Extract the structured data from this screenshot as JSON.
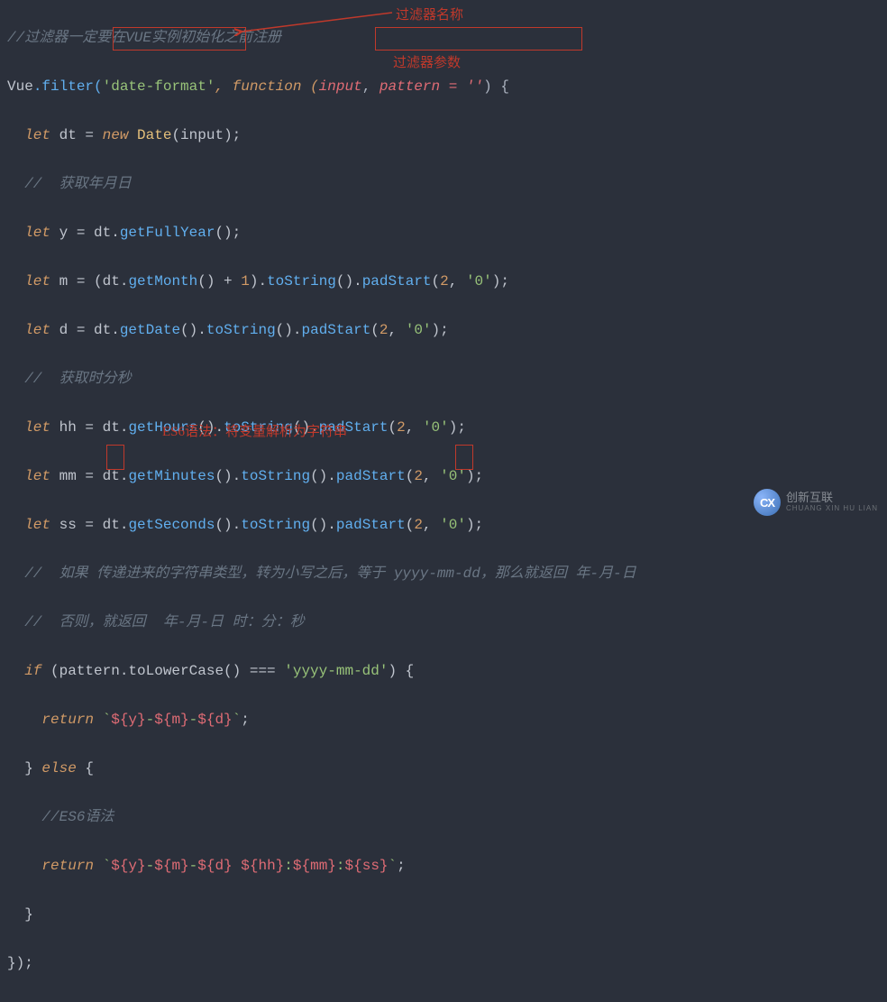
{
  "annotations": {
    "top_comment": "//过滤器一定要在VUE实例初始化之前注册",
    "filter_name_label": "过滤器名称",
    "filter_params_label": "过滤器参数",
    "es6_label": "ES6语法：将变量解析为字符串"
  },
  "code": {
    "l1_vue": "Vue",
    "l1_filter": ".filter(",
    "l1_name": "'date-format'",
    "l1_fn": ", function (",
    "l1_p1": "input",
    "l1_p_sep": ", ",
    "l1_p2": "pattern = ''",
    "l1_end": ") {",
    "l2_let": "let",
    "l2_rest": " dt = ",
    "l2_new": "new",
    "l2_date": " Date",
    "l2_args": "(input);",
    "l3_comment": "//  获取年月日",
    "l4": "let y = dt.getFullYear();",
    "l5": "let m = (dt.getMonth() + 1).toString().padStart(2, '0');",
    "l6": "let d = dt.getDate().toString().padStart(2, '0');",
    "l7_comment": "//  获取时分秒",
    "l8": "let hh = dt.getHours().toString().padStart(2, '0');",
    "l9": "let mm = dt.getMinutes().toString().padStart(2, '0');",
    "l10": "let ss = dt.getSeconds().toString().padStart(2, '0');",
    "l11_comment": "//  如果 传递进来的字符串类型，转为小写之后，等于 yyyy-mm-dd，那么就返回 年-月-日",
    "l12_comment": "//  否则，就返回  年-月-日 时：分：秒",
    "l13_if": "if",
    "l13_cond": " (pattern.toLowerCase() === ",
    "l13_str": "'yyyy-mm-dd'",
    "l13_end": ") {",
    "l14_return": "return",
    "l14_tmpl": " `${y}-${m}-${d}`;",
    "l15_else": "} else {",
    "l16_comment": "//ES6语法",
    "l17_return": "return",
    "l17_tmpl": " `${y}-${m}-${d} ${hh}:${mm}:${ss}`;",
    "l18": "}",
    "l19": "});"
  },
  "logo": {
    "icon_text": "CX",
    "brand_cn": "创新互联",
    "brand_py": "CHUANG XIN HU LIAN"
  }
}
